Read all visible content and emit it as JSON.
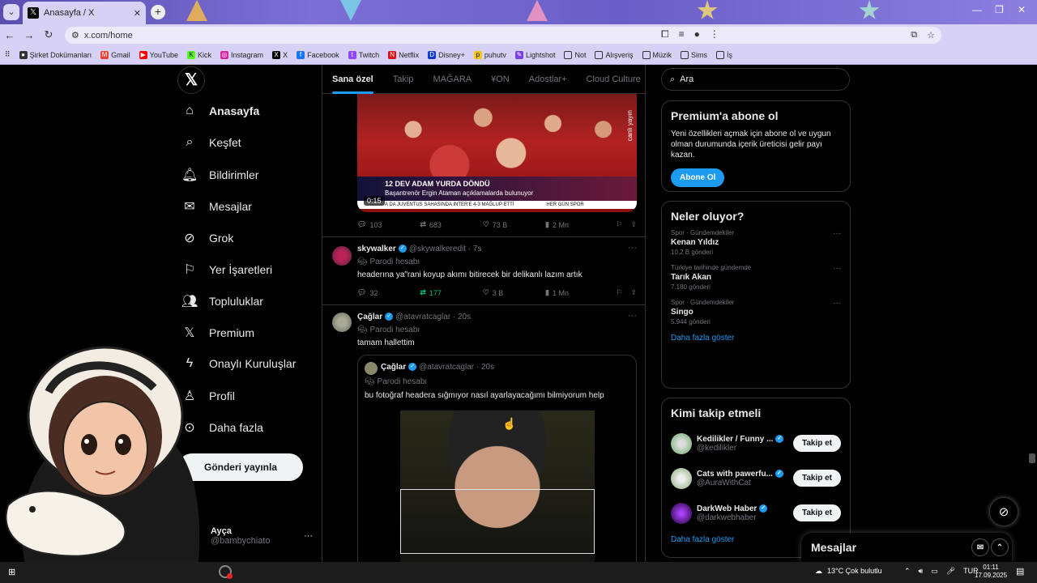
{
  "browser": {
    "tab_title": "Anasayfa / X",
    "tab_icon": "x-logo-icon",
    "url": "x.com/home",
    "bookmarks": [
      "Şirket Dokümanları",
      "Gmail",
      "YouTube",
      "Kick",
      "Instagram",
      "X",
      "Facebook",
      "Twitch",
      "Netflix",
      "Disney+",
      "puhutv",
      "Lightshot",
      "Not",
      "Alışveriş",
      "Müzik",
      "Sims",
      "İş"
    ]
  },
  "nav": {
    "items": [
      {
        "label": "Anasayfa",
        "icon": "home-icon"
      },
      {
        "label": "Keşfet",
        "icon": "search-icon"
      },
      {
        "label": "Bildirimler",
        "icon": "bell-icon"
      },
      {
        "label": "Mesajlar",
        "icon": "mail-icon"
      },
      {
        "label": "Grok",
        "icon": "grok-icon"
      },
      {
        "label": "Yer İşaretleri",
        "icon": "bookmark-icon"
      },
      {
        "label": "Topluluklar",
        "icon": "people-icon"
      },
      {
        "label": "Premium",
        "icon": "x-logo-icon"
      },
      {
        "label": "Onaylı Kuruluşlar",
        "icon": "lightning-icon"
      },
      {
        "label": "Profil",
        "icon": "person-icon"
      },
      {
        "label": "Daha fazla",
        "icon": "more-circle-icon"
      }
    ],
    "post_button": "Gönderi yayınla",
    "account_name": "Ayça",
    "account_handle": "@bambychiato"
  },
  "feed": {
    "tabs": [
      "Sana özel",
      "Takip",
      "MAĞARA",
      "¥ON",
      "Adostlar+",
      "Cloud Culture"
    ],
    "video": {
      "side_text": "canlı yayın",
      "headline": "12 DEV ADAM YURDA DÖNDÜ",
      "subline": "Başantrenör Ergin Ataman açıklamalarda bulunuyor",
      "ticker": "A DA JUVENTUS SAHASINDA INTER'E 4-3 MAĞLUP ETTİ",
      "channel": "HER GÜN SPOR",
      "time": "0:15"
    },
    "post0_actions": {
      "replies": "103",
      "reposts": "683",
      "likes": "73 B",
      "views": "2 Mn"
    },
    "post1": {
      "name": "skywalker",
      "handle": "@skywalkeredit",
      "time": "7s",
      "parody": "Parodi hesabı",
      "text": "headerına ya\"rani koyup akımı bitirecek bir delikanlı lazım artık",
      "replies": "32",
      "reposts": "177",
      "likes": "3 B",
      "views": "1 Mn"
    },
    "post2": {
      "name": "Çağlar",
      "handle": "@atavratcaglar",
      "time": "20s",
      "parody": "Parodi hesabı",
      "text": "tamam hallettim",
      "quote": {
        "name": "Çağlar",
        "handle": "@atavratcaglar",
        "time": "20s",
        "parody": "Parodi hesabı",
        "text": "bu fotoğraf headera sığmıyor nasıl ayarlayacağımı bilmiyorum help"
      }
    },
    "colors": {
      "accent": "#1d9bf0",
      "repost_active": "#00ba7c"
    }
  },
  "sidebar": {
    "search_placeholder": "Ara",
    "premium": {
      "title": "Premium'a abone ol",
      "text": "Yeni özellikleri açmak için abone ol ve uygun olman durumunda içerik üreticisi gelir payı kazan.",
      "button": "Abone Ol"
    },
    "trends": {
      "title": "Neler oluyor?",
      "items": [
        {
          "context": "Spor · Gündemdekiler",
          "name": "Kenan Yıldız",
          "count": "10,2 B gönderi"
        },
        {
          "context": "Türkiye tarihinde gündemde",
          "name": "Tarık Akan",
          "count": "7.180 gönderi"
        },
        {
          "context": "Spor · Gündemdekiler",
          "name": "Singo",
          "count": "5.944 gönderi"
        }
      ],
      "more": "Daha fazla göster"
    },
    "who": {
      "title": "Kimi takip etmeli",
      "items": [
        {
          "name": "Kedilikler / Funny ...",
          "handle": "@kedilikler",
          "button": "Takip et"
        },
        {
          "name": "Cats with pawerfu...",
          "handle": "@AuraWithCat",
          "button": "Takip et"
        },
        {
          "name": "DarkWeb Haber",
          "handle": "@darkwebhaber",
          "button": "Takip et"
        }
      ],
      "more": "Daha fazla göster"
    }
  },
  "messages_dock": "Mesajlar",
  "taskbar": {
    "weather": "13°C  Çok bulutlu",
    "lang": "TUR",
    "time": "01:11",
    "date": "17.09.2025"
  }
}
